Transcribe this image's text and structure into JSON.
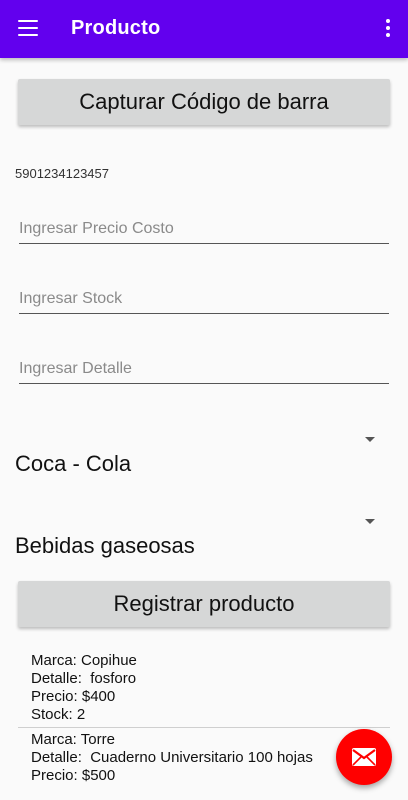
{
  "appbar": {
    "title": "Producto",
    "menu_icon": "hamburger-menu-icon",
    "more_icon": "more-vert-icon",
    "color": "#6200ee"
  },
  "form": {
    "capture_button_label": "Capturar Código de barra",
    "barcode_value": "5901234123457",
    "price_placeholder": "Ingresar Precio Costo",
    "stock_placeholder": "Ingresar Stock",
    "detail_placeholder": "Ingresar Detalle",
    "brand_selected": "Coca - Cola",
    "category_selected": "Bebidas gaseosas",
    "register_button_label": "Registrar producto"
  },
  "products": [
    {
      "marca": "Marca: Copihue",
      "detalle": "Detalle:  fosforo",
      "precio": "Precio: $400",
      "stock": "Stock: 2"
    },
    {
      "marca": "Marca: Torre",
      "detalle": "Detalle:  Cuaderno Universitario 100 hojas",
      "precio": "Precio: $500"
    }
  ],
  "fab": {
    "icon": "mail-icon",
    "color": "#ff0000"
  }
}
